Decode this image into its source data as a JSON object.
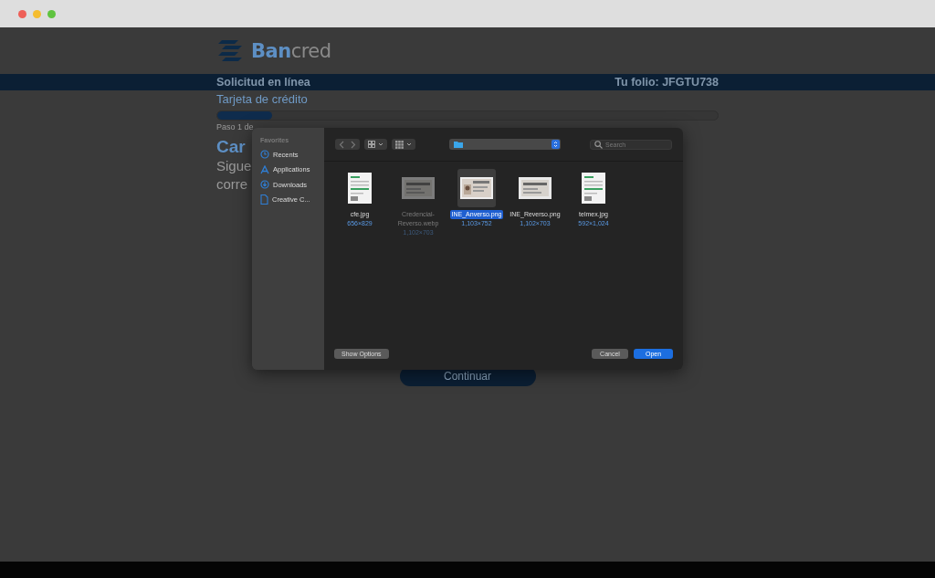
{
  "browser": {
    "dots": [
      {
        "color": "#ee5f57"
      },
      {
        "color": "#f5bd2f"
      },
      {
        "color": "#5fc33f"
      }
    ]
  },
  "brand": {
    "bold": "Ban",
    "light": "cred"
  },
  "header": {
    "title": "Solicitud en línea",
    "folio": "Tu folio: JFGTU738"
  },
  "product": "Tarjeta de crédito",
  "progress": {
    "level": 0.11,
    "label": "Paso 1 de"
  },
  "heading": "Car",
  "lines": [
    "Sigue",
    "corre"
  ],
  "continue_button": "Continuar",
  "dialog": {
    "sidebar": {
      "section": "Favorites",
      "items": [
        {
          "label": "Recents"
        },
        {
          "label": "Applications"
        },
        {
          "label": "Downloads"
        },
        {
          "label": "Creative C..."
        }
      ]
    },
    "search": {
      "placeholder": "Search"
    },
    "files": [
      {
        "name": "cfe.jpg",
        "size": "656×829",
        "kind": "document",
        "selected": false,
        "disabled": false
      },
      {
        "name": "Credencial-Reverso.webp",
        "size": "1,102×703",
        "kind": "card",
        "selected": false,
        "disabled": true
      },
      {
        "name": "INE_Anverso.png",
        "size": "1,103×752",
        "kind": "photo-card",
        "selected": true,
        "disabled": false
      },
      {
        "name": "INE_Reverso.png",
        "size": "1,102×703",
        "kind": "card",
        "selected": false,
        "disabled": false
      },
      {
        "name": "telmex.jpg",
        "size": "592×1,024",
        "kind": "document",
        "selected": false,
        "disabled": false
      }
    ],
    "options_button": "Show Options",
    "cancel_button": "Cancel",
    "open_button": "Open"
  }
}
